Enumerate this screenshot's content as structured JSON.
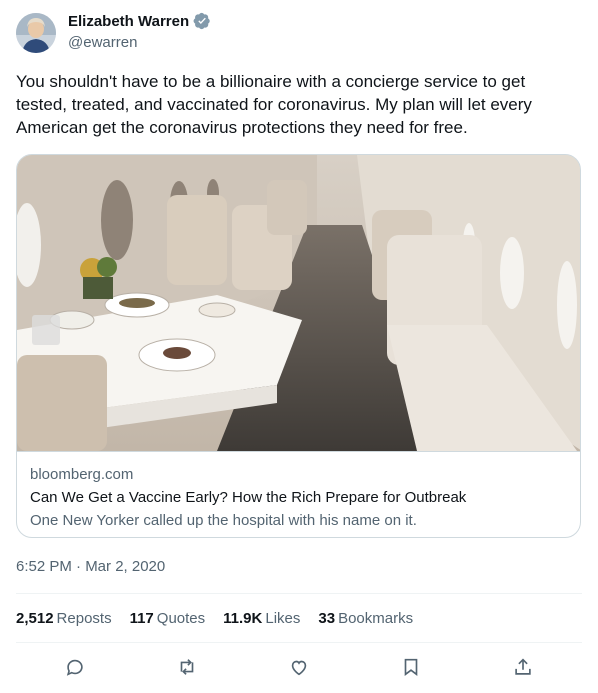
{
  "author": {
    "display_name": "Elizabeth Warren",
    "handle": "@ewarren",
    "verified": true
  },
  "tweet": {
    "text": "You shouldn't have to be a billionaire with a concierge service to get tested, treated, and vaccinated for coronavirus. My plan will let every American get the coronavirus protections they need for free."
  },
  "card": {
    "domain": "bloomberg.com",
    "title": "Can We Get a Vaccine Early? How the Rich Prepare for Outbreak",
    "description": "One New Yorker called up the hospital with his name on it."
  },
  "timestamp": "6:52 PM · Mar 2, 2020",
  "stats": [
    {
      "count": "2,512",
      "label": "Reposts"
    },
    {
      "count": "117",
      "label": "Quotes"
    },
    {
      "count": "11.9K",
      "label": "Likes"
    },
    {
      "count": "33",
      "label": "Bookmarks"
    }
  ],
  "actions": [
    "reply-icon",
    "retweet-icon",
    "like-icon",
    "bookmark-icon",
    "share-icon"
  ],
  "colors": {
    "text": "#0f1419",
    "secondary": "#536471",
    "border": "#cfd9de",
    "divider": "#eff3f4",
    "verified": "#829aab"
  }
}
